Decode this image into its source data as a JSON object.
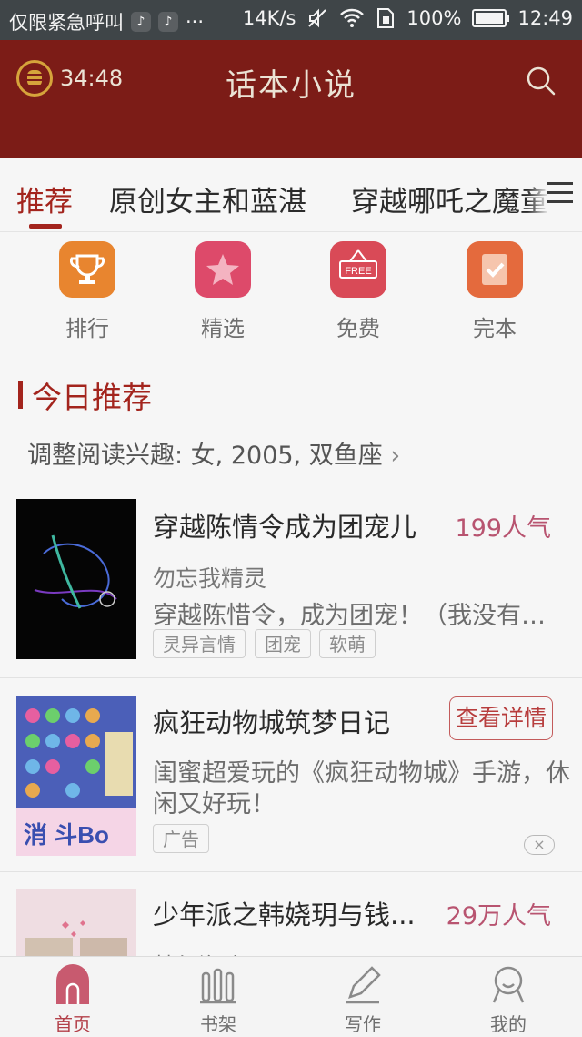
{
  "status_bar": {
    "carrier": "仅限紧急呼叫",
    "more": "···",
    "net_speed": "14K/s",
    "battery": "100%",
    "time": "12:49"
  },
  "header": {
    "timer": "34:48",
    "title": "话本小说"
  },
  "tabs": [
    "推荐",
    "原创女主和蓝湛",
    "穿越哪吒之魔童"
  ],
  "quick_links": [
    {
      "label": "排行",
      "icon": "trophy-icon",
      "color": "#e8852f"
    },
    {
      "label": "精选",
      "icon": "star-icon",
      "color": "#dd4a6a"
    },
    {
      "label": "免费",
      "icon": "free-sign-icon",
      "color": "#d94a57",
      "badge": "FREE"
    },
    {
      "label": "完本",
      "icon": "checkmark-icon",
      "color": "#e46a3d"
    }
  ],
  "section": {
    "title": "今日推荐",
    "interest": "调整阅读兴趣: 女, 2005, 双鱼座"
  },
  "cards": [
    {
      "title": "穿越陈情令成为团宠儿",
      "popularity": "199人气",
      "author": "勿忘我精灵",
      "desc": "穿越陈惜令，成为团宠！（我没有写错字）",
      "tags": [
        "灵异言情",
        "团宠",
        "软萌"
      ]
    },
    {
      "title": "疯狂动物城筑梦日记",
      "button": "查看详情",
      "desc_line1": "闺蜜超爱玩的《疯狂动物城》手游，休",
      "desc_line2": "闲又好玩！",
      "ad_tag": "广告",
      "close": "×"
    },
    {
      "title": "少年派之韩娆玥与钱...",
      "popularity": "29万人气",
      "author": "梦幻海迪"
    }
  ],
  "bottom_nav": [
    "首页",
    "书架",
    "写作",
    "我的"
  ],
  "colors": {
    "header": "#7c1c17",
    "accent": "#a3241d",
    "popularity": "#b85470"
  }
}
